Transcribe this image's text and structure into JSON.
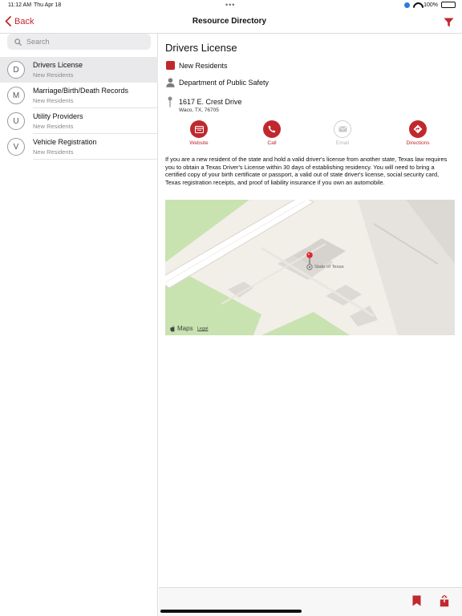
{
  "status_bar": {
    "time": "11:12 AM",
    "date": "Thu Apr 18",
    "multitask_dots": "•••",
    "battery_percent": "100%",
    "battery_level": 1.0
  },
  "nav": {
    "back_label": "Back",
    "title": "Resource Directory",
    "filter_icon": "filter-icon"
  },
  "search": {
    "placeholder": "Search",
    "icon": "search-icon"
  },
  "list": [
    {
      "letter": "D",
      "title": "Drivers License",
      "subtitle": "New Residents",
      "selected": true
    },
    {
      "letter": "M",
      "title": "Marriage/Birth/Death Records",
      "subtitle": "New Residents",
      "selected": false
    },
    {
      "letter": "U",
      "title": "Utility Providers",
      "subtitle": "New Residents",
      "selected": false
    },
    {
      "letter": "V",
      "title": "Vehicle Registration",
      "subtitle": "New Residents",
      "selected": false
    }
  ],
  "detail": {
    "title": "Drivers License",
    "category": "New Residents",
    "agency": "Department of Public Safety",
    "address_line1": "1617 E. Crest Drive",
    "address_line2": "Waco, TX, 76705",
    "actions": {
      "website": "Website",
      "call": "Call",
      "email": "Email",
      "directions": "Directions"
    },
    "description": "If you are a new resident of the state and hold a valid driver's license from another state, Texas law requires you to obtain a Texas Driver's License within 30 days of establishing residency. You will need to bring a certified copy of your birth certificate or passport, a valid out of state driver's license, social security card, Texas registration receipts, and proof of liability insurance if you own an automobile."
  },
  "map": {
    "place_label": "State of Texas",
    "brand": "Maps",
    "legal": "Legal"
  },
  "colors": {
    "accent": "#c0282d",
    "park_green": "#c8e3b0",
    "map_bg": "#f2efe9"
  }
}
